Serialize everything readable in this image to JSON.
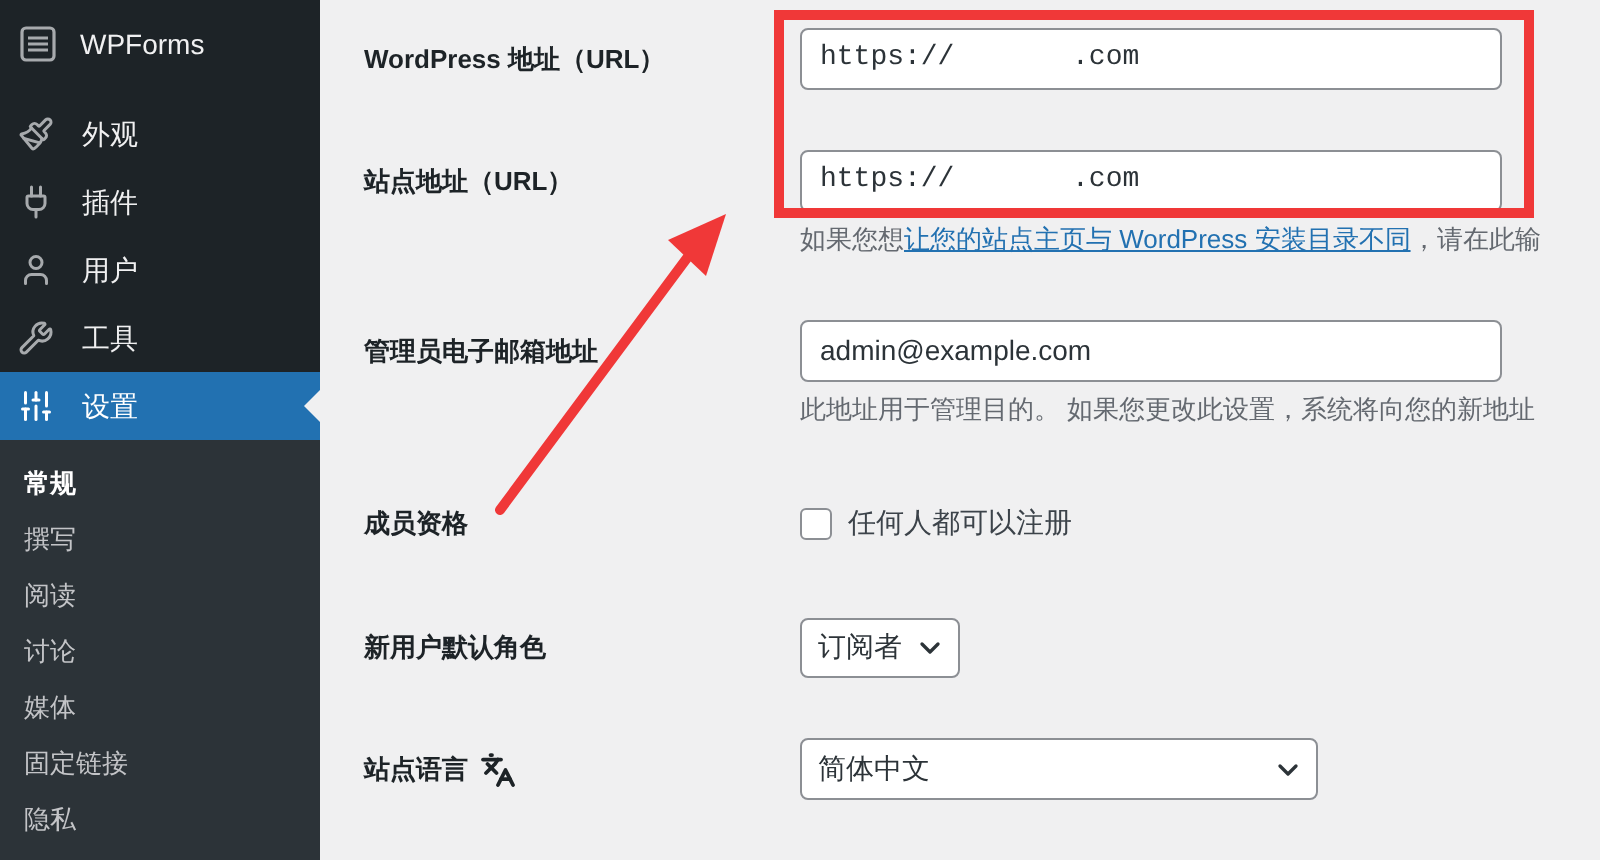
{
  "sidebar": {
    "brand": "WPForms",
    "items": [
      {
        "label": "外观",
        "selected": false
      },
      {
        "label": "插件",
        "selected": false
      },
      {
        "label": "用户",
        "selected": false
      },
      {
        "label": "工具",
        "selected": false
      },
      {
        "label": "设置",
        "selected": true
      }
    ],
    "submenu": [
      {
        "label": "常规",
        "selected": true
      },
      {
        "label": "撰写",
        "selected": false
      },
      {
        "label": "阅读",
        "selected": false
      },
      {
        "label": "讨论",
        "selected": false
      },
      {
        "label": "媒体",
        "selected": false
      },
      {
        "label": "固定链接",
        "selected": false
      },
      {
        "label": "隐私",
        "selected": false
      }
    ]
  },
  "settings": [
    {
      "kind": "text",
      "label": "WordPress 地址（URL）",
      "value": "https://       .com"
    },
    {
      "kind": "text",
      "label": "站点地址（URL）",
      "value": "https://       .com",
      "hint": {
        "before": "如果您想",
        "link": "让您的站点主页与 WordPress 安装目录不同",
        "after": "，请在此输"
      }
    },
    {
      "kind": "text",
      "label": "管理员电子邮箱地址",
      "value": "admin@example.com",
      "hint": {
        "before": "此地址用于管理目的。 如果您更改此设置，系统将向您的新地址"
      }
    },
    {
      "kind": "checkbox",
      "label": "成员资格",
      "option": "任何人都可以注册",
      "checked": false
    },
    {
      "kind": "select",
      "label": "新用户默认角色",
      "value": "订阅者"
    },
    {
      "kind": "language",
      "label": "站点语言",
      "value": "简体中文"
    }
  ]
}
